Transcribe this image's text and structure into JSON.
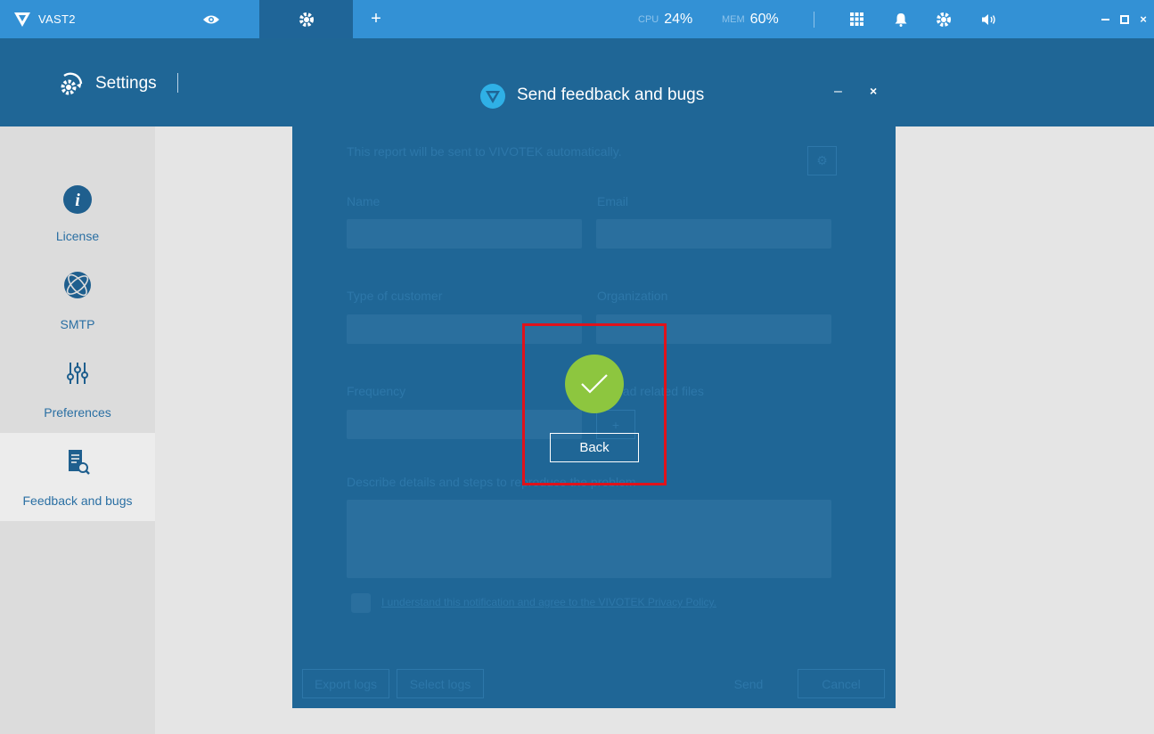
{
  "titlebar": {
    "app_name": "VAST2",
    "cpu_label": "CPU",
    "cpu_value": "24%",
    "mem_label": "MEM",
    "mem_value": "60%"
  },
  "header": {
    "title": "Settings"
  },
  "sidebar": {
    "items": [
      {
        "label": "License",
        "icon": "info-icon"
      },
      {
        "label": "SMTP",
        "icon": "globe-icon"
      },
      {
        "label": "Preferences",
        "icon": "sliders-icon"
      },
      {
        "label": "Feedback and bugs",
        "icon": "document-search-icon",
        "active": true
      }
    ]
  },
  "dialog": {
    "title": "Send feedback and bugs",
    "intro": "This report will be sent to VIVOTEK automatically.",
    "name_label": "Name",
    "email_label": "Email",
    "type_label": "Type of customer",
    "org_label": "Organization",
    "frequency_label": "Frequency",
    "related_files_label": "Upload related files",
    "describe_label": "Describe details and steps to reproduce the problem",
    "consent_text": "I understand this notification and agree to the VIVOTEK Privacy Policy.",
    "export_logs": "Export logs",
    "select_logs": "Select logs",
    "send": "Send",
    "cancel": "Cancel",
    "back": "Back"
  },
  "colors": {
    "titlebar": "#3391d5",
    "header": "#1f6696",
    "success": "#8dc63f",
    "highlight": "#e0121b"
  }
}
